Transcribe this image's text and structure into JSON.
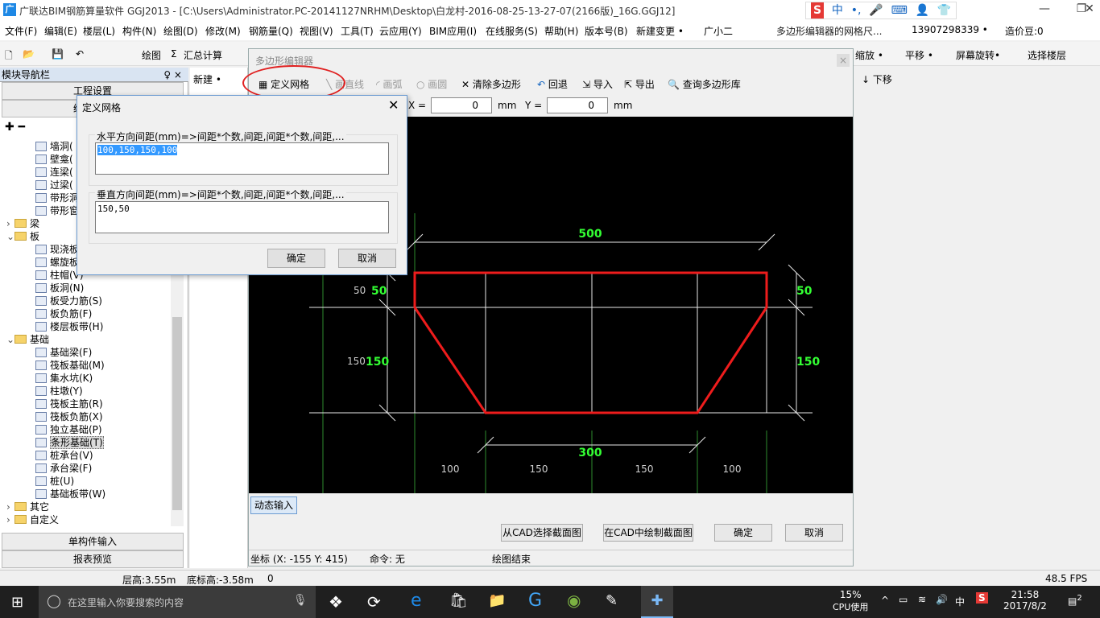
{
  "window": {
    "title": "广联达BIM钢筋算量软件 GGJ2013 - [C:\\Users\\Administrator.PC-20141127NRHM\\Desktop\\白龙村-2016-08-25-13-27-07(2166版)_16G.GGJ12]",
    "app_icon": "广"
  },
  "ime": {
    "brand": "S",
    "lang": "中",
    "punct": "•,",
    "mic": "mic-icon",
    "kbd": "keyboard-icon",
    "user": "user-icon",
    "shirt": "shirt-icon",
    "tool": "wrench-icon"
  },
  "menu": [
    "文件(F)",
    "编辑(E)",
    "楼层(L)",
    "构件(N)",
    "绘图(D)",
    "修改(M)",
    "钢筋量(Q)",
    "视图(V)",
    "工具(T)",
    "云应用(Y)",
    "BIM应用(I)",
    "在线服务(S)",
    "帮助(H)",
    "版本号(B)",
    "新建变更 •",
    "广小二",
    "多边形编辑器的网格尺...",
    "13907298339 •",
    "造价豆:0"
  ],
  "toolbar": {
    "draw": "绘图",
    "sum": "汇总计算",
    "zoom": "缩放 •",
    "pan": "平移 •",
    "rotate": "屏幕旋转•",
    "select_floor": "选择楼层",
    "move_down": "下移"
  },
  "nav": {
    "header": "模块导航栏",
    "pin": "♀ ×",
    "project": "工程设置",
    "draw": "绘图输入",
    "single": "单构件输入",
    "report": "报表预览"
  },
  "tree": [
    {
      "label": "墙洞(",
      "indent": 2,
      "icon": "item"
    },
    {
      "label": "壁龛(",
      "indent": 2,
      "icon": "item"
    },
    {
      "label": "连梁(",
      "indent": 2,
      "icon": "item"
    },
    {
      "label": "过梁(",
      "indent": 2,
      "icon": "item"
    },
    {
      "label": "带形洞",
      "indent": 2,
      "icon": "item"
    },
    {
      "label": "带形窗",
      "indent": 2,
      "icon": "item"
    },
    {
      "label": "梁",
      "indent": 0,
      "icon": "folder",
      "exp": ">"
    },
    {
      "label": "板",
      "indent": 0,
      "icon": "folder",
      "exp": "v"
    },
    {
      "label": "现浇板",
      "indent": 2,
      "icon": "item"
    },
    {
      "label": "螺旋板",
      "indent": 2,
      "icon": "item"
    },
    {
      "label": "柱帽(V)",
      "indent": 2,
      "icon": "item"
    },
    {
      "label": "板洞(N)",
      "indent": 2,
      "icon": "item"
    },
    {
      "label": "板受力筋(S)",
      "indent": 2,
      "icon": "item"
    },
    {
      "label": "板负筋(F)",
      "indent": 2,
      "icon": "item"
    },
    {
      "label": "楼层板带(H)",
      "indent": 2,
      "icon": "item"
    },
    {
      "label": "基础",
      "indent": 0,
      "icon": "folder",
      "exp": "v"
    },
    {
      "label": "基础梁(F)",
      "indent": 2,
      "icon": "item"
    },
    {
      "label": "筏板基础(M)",
      "indent": 2,
      "icon": "item"
    },
    {
      "label": "集水坑(K)",
      "indent": 2,
      "icon": "item"
    },
    {
      "label": "柱墩(Y)",
      "indent": 2,
      "icon": "item"
    },
    {
      "label": "筏板主筋(R)",
      "indent": 2,
      "icon": "item"
    },
    {
      "label": "筏板负筋(X)",
      "indent": 2,
      "icon": "item"
    },
    {
      "label": "独立基础(P)",
      "indent": 2,
      "icon": "item"
    },
    {
      "label": "条形基础(T)",
      "indent": 2,
      "icon": "item",
      "selected": true
    },
    {
      "label": "桩承台(V)",
      "indent": 2,
      "icon": "item"
    },
    {
      "label": "承台梁(F)",
      "indent": 2,
      "icon": "item"
    },
    {
      "label": "桩(U)",
      "indent": 2,
      "icon": "item"
    },
    {
      "label": "基础板带(W)",
      "indent": 2,
      "icon": "item"
    },
    {
      "label": "其它",
      "indent": 0,
      "icon": "folder",
      "exp": ">"
    },
    {
      "label": "自定义",
      "indent": 0,
      "icon": "folder",
      "exp": ">"
    }
  ],
  "mid": {
    "new": "新建 •"
  },
  "poly": {
    "title": "多边形编辑器",
    "tools": {
      "grid": "定义网格",
      "line": "画直线",
      "arc": "画弧",
      "circle": "画圆",
      "clear": "清除多边形",
      "undo": "回退",
      "import": "导入",
      "export": "导出",
      "query": "查询多边形库"
    },
    "x_label": "X =",
    "x_val": "0",
    "y_label": "Y =",
    "y_val": "0",
    "unit": "mm",
    "dyn": "动态输入",
    "from_cad": "从CAD选择截面图",
    "draw_cad": "在CAD中绘制截面图",
    "ok": "确定",
    "cancel": "取消",
    "status_coord": "坐标 (X: -155 Y: 415)",
    "status_cmd": "命令: 无",
    "status_draw": "绘图结束"
  },
  "canvas": {
    "top": "500",
    "bottom": "300",
    "l50": "50",
    "l50w": "50",
    "l150": "150",
    "l150w": "150",
    "r50": "50",
    "r150": "150",
    "h": [
      "100",
      "150",
      "150",
      "100"
    ]
  },
  "dialog": {
    "title": "定义网格",
    "h_label": "水平方向间距(mm)=>间距*个数,间距,间距*个数,间距,...",
    "h_value": "100,150,150,100",
    "v_label": "垂直方向间距(mm)=>间距*个数,间距,间距*个数,间距,...",
    "v_value": "150,50",
    "ok": "确定",
    "cancel": "取消"
  },
  "status": {
    "floor_h": "层高:3.55m",
    "base_h": "底标高:-3.58m",
    "zero": "0",
    "fps": "48.5 FPS"
  },
  "taskbar": {
    "search": "在这里输入你要搜索的内容",
    "cpu": "15%",
    "cpu_label": "CPU使用",
    "lang": "中",
    "time": "21:58",
    "date": "2017/8/2",
    "notif": "2"
  }
}
